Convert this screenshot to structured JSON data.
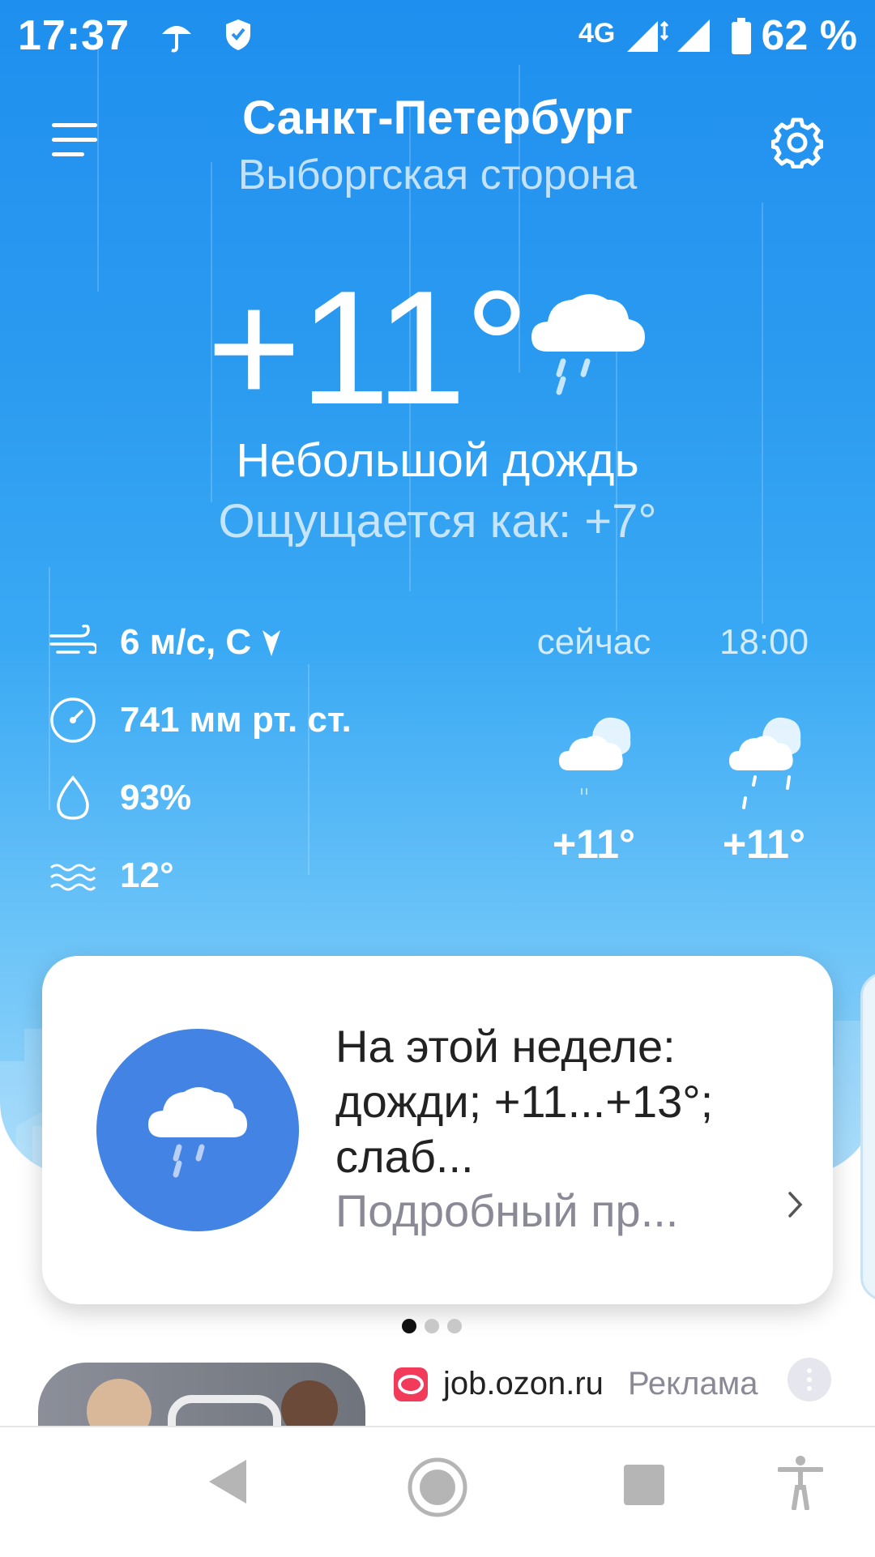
{
  "status_bar": {
    "time": "17:37",
    "network": "4G",
    "battery": "62 %",
    "icons": [
      "umbrella-icon",
      "shield-icon",
      "signal-icon",
      "battery-icon"
    ]
  },
  "header": {
    "city": "Санкт-Петербург",
    "district": "Выборгская сторона",
    "menu_icon": "hamburger-icon",
    "settings_icon": "gear-icon"
  },
  "current": {
    "temperature": "+11°",
    "condition": "Небольшой дождь",
    "feels_like": "Ощущается как: +7°",
    "icon": "cloud-rain-icon"
  },
  "stats": [
    {
      "icon": "wind-icon",
      "value": "6 м/с, С"
    },
    {
      "icon": "pressure-icon",
      "value": "741 мм рт. ст."
    },
    {
      "icon": "humidity-icon",
      "value": "93%"
    },
    {
      "icon": "water-icon",
      "value": "12°"
    }
  ],
  "hourly": [
    {
      "label": "сейчас",
      "temp": "+11°",
      "icon": "cloudy-drizzle-icon"
    },
    {
      "label": "18:00",
      "temp": "+11°",
      "icon": "cloudy-rain-icon"
    }
  ],
  "forecast_card": {
    "text": "На этой неделе: дожди; +11...+13°; слаб...",
    "more": "Подробный пр...",
    "icon": "cloud-rain-icon",
    "chevron": "chevron-right-icon"
  },
  "pager": {
    "count": 3,
    "active": 0
  },
  "ad": {
    "site": "job.ozon.ru",
    "label": "Реклама",
    "menu_icon": "more-vertical-icon"
  },
  "nav": [
    "back-icon",
    "home-icon",
    "recents-icon",
    "accessibility-icon"
  ],
  "colors": {
    "sky_top": "#1f8fef",
    "sky_bottom": "#9ad6fb",
    "card_icon_bg": "#4383e4",
    "secondary_text": "#8a8a96"
  }
}
